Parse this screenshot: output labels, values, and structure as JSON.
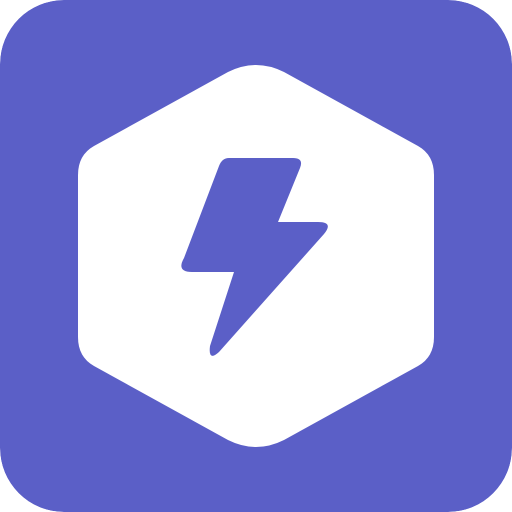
{
  "icon": {
    "name": "lightning-bolt-app-icon",
    "glyph": "lightning-bolt-icon",
    "container_shape": "hexagon"
  },
  "colors": {
    "background": "#5B5FC7",
    "hexagon": "#FFFFFF",
    "bolt": "#5B5FC7"
  }
}
